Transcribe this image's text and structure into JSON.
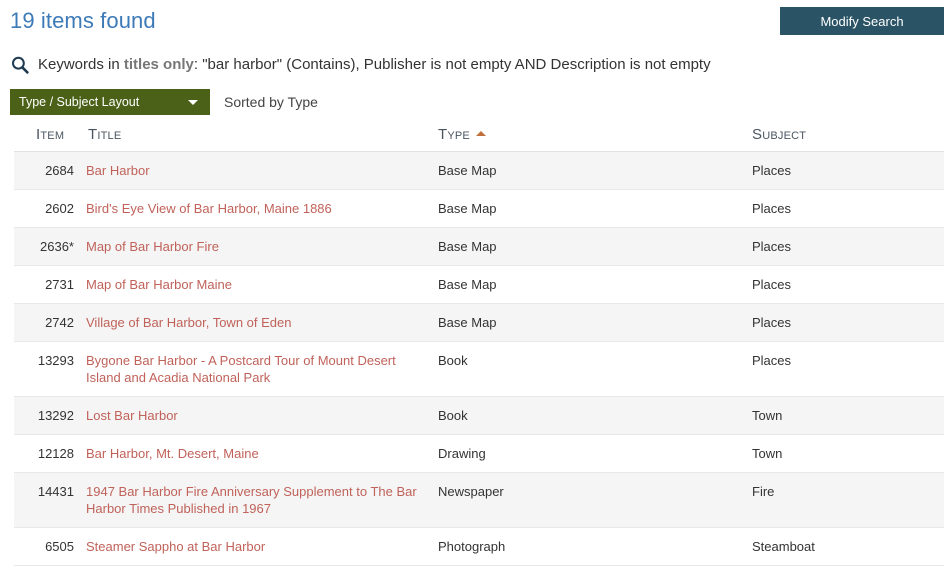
{
  "header": {
    "items_found": "19 items found",
    "modify_search_label": "Modify Search",
    "search_icon": "search-icon"
  },
  "criteria": {
    "prefix": "Keywords in ",
    "field": "titles only",
    "suffix": ": \"bar harbor\" (Contains), Publisher is not empty AND Description is not empty"
  },
  "layout": {
    "selected": "Type / Subject Layout",
    "caret_icon": "chevron-down-icon",
    "sorted_by": "Sorted by Type"
  },
  "table": {
    "columns": [
      {
        "key": "item",
        "label": "Item",
        "sorted": false
      },
      {
        "key": "title",
        "label": "Title",
        "sorted": false
      },
      {
        "key": "type",
        "label": "Type",
        "sorted": true,
        "sort_direction": "asc",
        "sort_icon": "sort-ascending-icon"
      },
      {
        "key": "subject",
        "label": "Subject",
        "sorted": false
      }
    ],
    "rows": [
      {
        "item": "2684",
        "title": "Bar Harbor",
        "type": "Base Map",
        "subject": "Places"
      },
      {
        "item": "2602",
        "title": "Bird's Eye View of Bar Harbor, Maine 1886",
        "type": "Base Map",
        "subject": "Places"
      },
      {
        "item": "2636*",
        "title": "Map of Bar Harbor Fire",
        "type": "Base Map",
        "subject": "Places"
      },
      {
        "item": "2731",
        "title": "Map of Bar Harbor Maine",
        "type": "Base Map",
        "subject": "Places"
      },
      {
        "item": "2742",
        "title": "Village of Bar Harbor, Town of Eden",
        "type": "Base Map",
        "subject": "Places"
      },
      {
        "item": "13293",
        "title": "Bygone Bar Harbor - A Postcard Tour of Mount Desert Island and Acadia National Park",
        "type": "Book",
        "subject": "Places"
      },
      {
        "item": "13292",
        "title": "Lost Bar Harbor",
        "type": "Book",
        "subject": "Town"
      },
      {
        "item": "12128",
        "title": "Bar Harbor, Mt. Desert, Maine",
        "type": "Drawing",
        "subject": "Town"
      },
      {
        "item": "14431",
        "title": "1947 Bar Harbor Fire Anniversary Supplement to The Bar Harbor Times Published in 1967",
        "type": "Newspaper",
        "subject": "Fire"
      },
      {
        "item": "6505",
        "title": "Steamer Sappho at Bar Harbor",
        "type": "Photograph",
        "subject": "Steamboat"
      }
    ]
  },
  "colors": {
    "heading": "#3d7ab8",
    "modify_button": "#2a5466",
    "layout_select": "#4c6118",
    "link": "#c0625a",
    "sort_arrow": "#c0703a",
    "row_alt": "#f5f5f5"
  }
}
